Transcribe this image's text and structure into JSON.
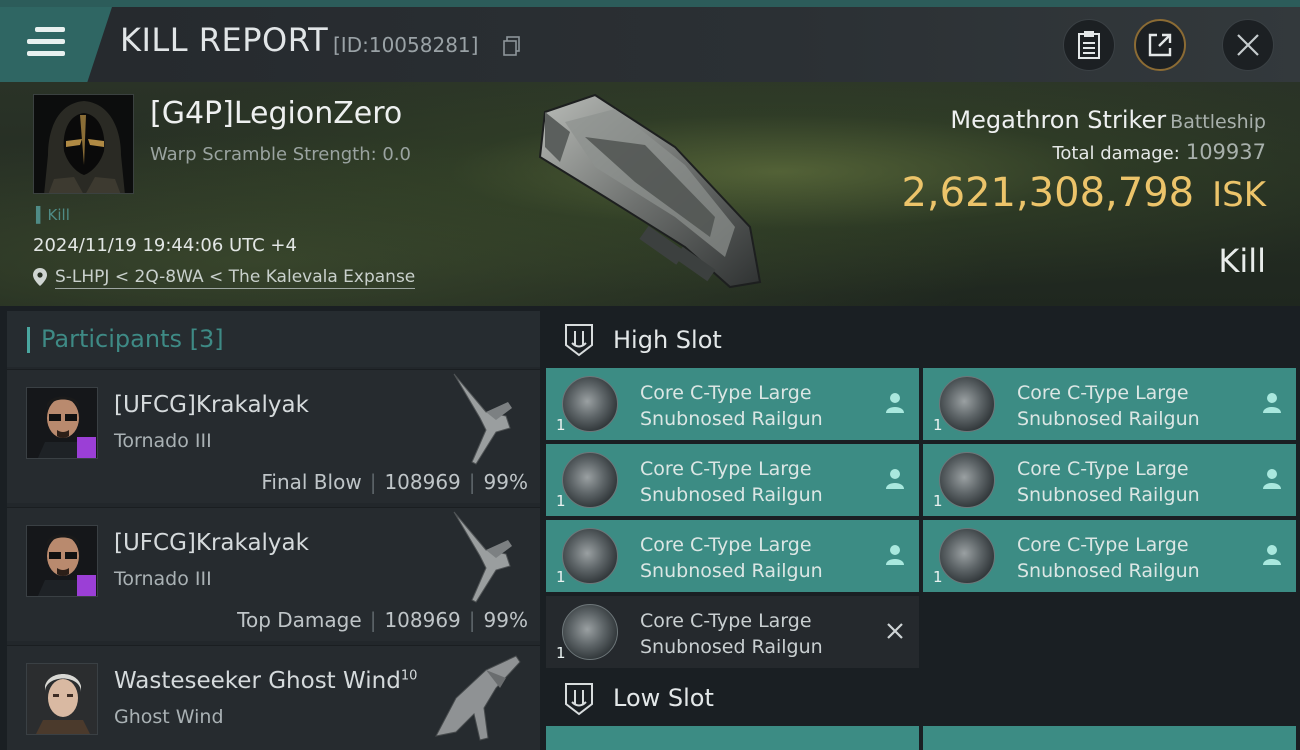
{
  "header": {
    "title": "KILL REPORT",
    "report_id": "[ID:10058281]",
    "icons": [
      "menu-icon",
      "copy-icon",
      "clipboard-icon",
      "share-icon",
      "close-icon"
    ]
  },
  "victim": {
    "name": "[G4P]LegionZero",
    "warp_scramble": "Warp Scramble Strength: 0.0",
    "kill_tag": "Kill",
    "datetime": "2024/11/19 19:44:06 UTC +4",
    "location": "S-LHPJ < 2Q-8WA < The Kalevala Expanse",
    "ship_name": "Megathron Striker",
    "ship_class": "Battleship",
    "total_damage_label": "Total damage:",
    "total_damage_value": "109937",
    "isk_value": "2,621,308,798",
    "isk_unit": "ISK",
    "result": "Kill"
  },
  "participants": {
    "title": "Participants",
    "count": "[3]",
    "items": [
      {
        "name": "[UFCG]Krakalyak",
        "ship": "Tornado III",
        "role": "Final Blow",
        "damage": "108969",
        "percent": "99%"
      },
      {
        "name": "[UFCG]Krakalyak",
        "ship": "Tornado III",
        "role": "Top Damage",
        "damage": "108969",
        "percent": "99%"
      },
      {
        "name": "Wasteseeker Ghost Wind",
        "level": "10",
        "ship": "Ghost Wind"
      }
    ]
  },
  "slots": {
    "high_title": "High Slot",
    "low_title": "Low Slot",
    "items": [
      {
        "qty": "1",
        "name_l1": "Core C-Type Large",
        "name_l2": "Snubnosed Railgun",
        "status": "dropped"
      },
      {
        "qty": "1",
        "name_l1": "Core C-Type Large",
        "name_l2": "Snubnosed Railgun",
        "status": "dropped"
      },
      {
        "qty": "1",
        "name_l1": "Core C-Type Large",
        "name_l2": "Snubnosed Railgun",
        "status": "dropped"
      },
      {
        "qty": "1",
        "name_l1": "Core C-Type Large",
        "name_l2": "Snubnosed Railgun",
        "status": "dropped"
      },
      {
        "qty": "1",
        "name_l1": "Core C-Type Large",
        "name_l2": "Snubnosed Railgun",
        "status": "dropped"
      },
      {
        "qty": "1",
        "name_l1": "Core C-Type Large",
        "name_l2": "Snubnosed Railgun",
        "status": "dropped"
      },
      {
        "qty": "1",
        "name_l1": "Core C-Type Large",
        "name_l2": "Snubnosed Railgun",
        "status": "destroyed"
      }
    ]
  },
  "colors": {
    "accent_teal": "#3c8c84",
    "isk_gold": "#ecc46a",
    "badge_purple": "#9b3fd6"
  }
}
